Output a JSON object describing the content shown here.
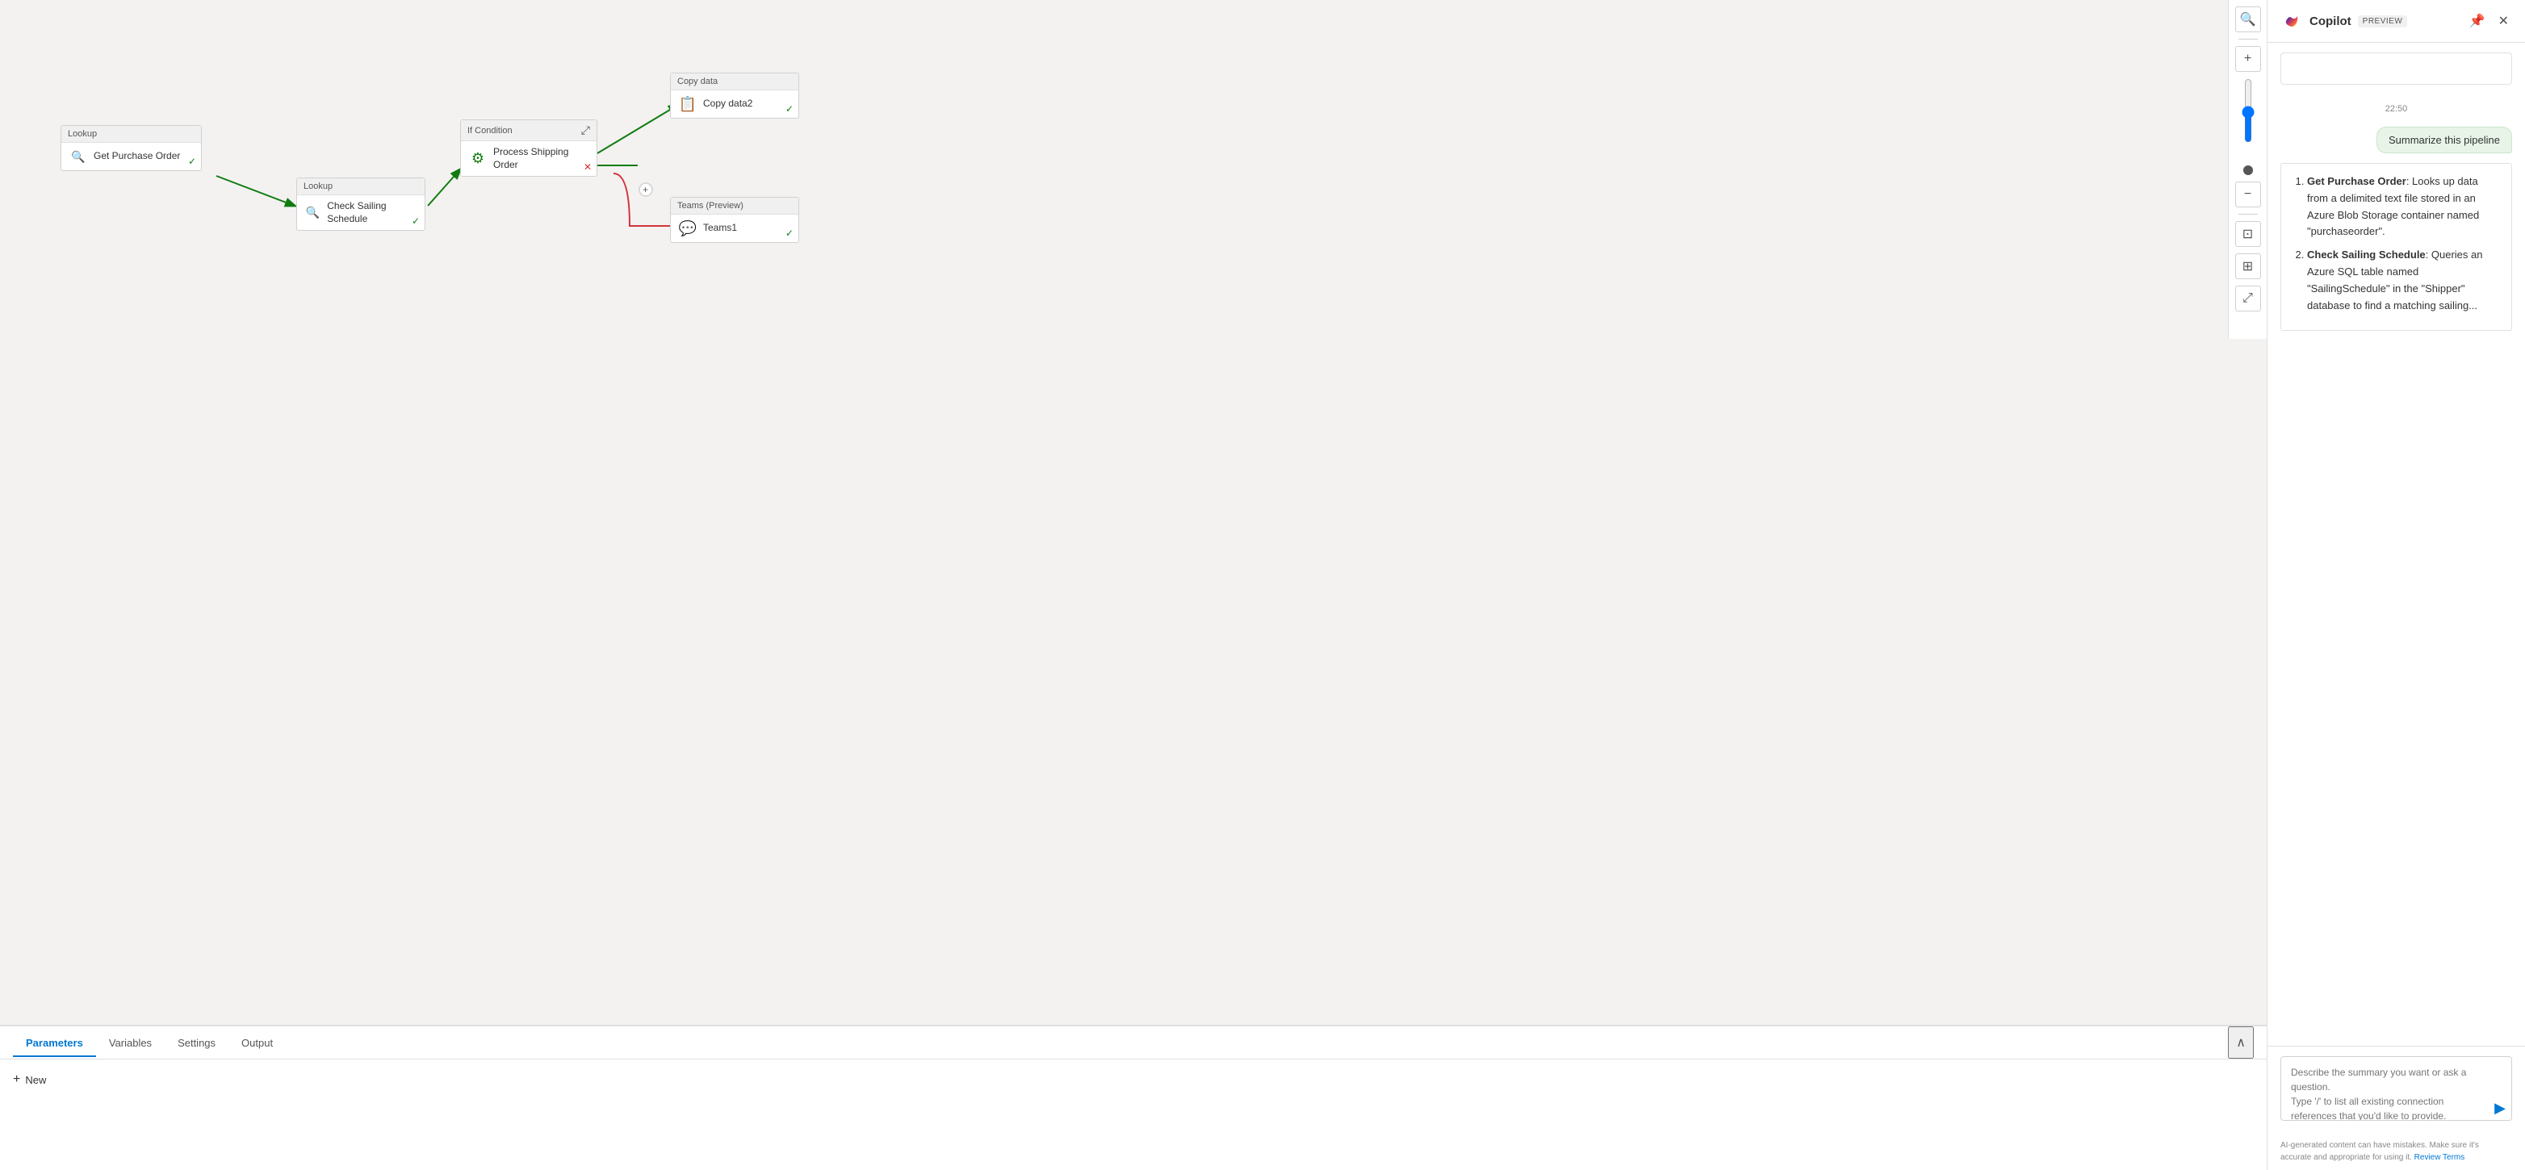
{
  "copilot": {
    "title": "Copilot",
    "preview_badge": "PREVIEW",
    "timestamp": "22:50",
    "user_message": "Summarize this pipeline",
    "bot_response": {
      "items": [
        {
          "name": "Get Purchase Order",
          "description": ": Looks up data from a delimited text file stored in an Azure Blob Storage container named \"purchaseorder\"."
        },
        {
          "name": "Check Sailing Schedule",
          "description": ": Queries an Azure SQL table named \"SailingSchedule\" in the \"Shipper\" database to find a matching sailing..."
        }
      ]
    },
    "input_placeholder": "Describe the summary you want or ask a question.\nType '/' to list all existing connection references that you'd like to provide.",
    "footer_text": "AI-generated content can have mistakes. Make sure it's accurate and appropriate for using it. ",
    "review_terms": "Review Terms"
  },
  "nodes": {
    "lookup1": {
      "header": "Lookup",
      "label": "Get Purchase Order"
    },
    "lookup2": {
      "header": "Lookup",
      "label": "Check Sailing Schedule"
    },
    "ifcondition": {
      "header": "If Condition",
      "label": ""
    },
    "process_shipping": {
      "header": "",
      "label": "Process Shipping Order"
    },
    "copy_data": {
      "header": "Copy data",
      "label": "Copy data2"
    },
    "teams": {
      "header": "Teams (Preview)",
      "label": "Teams1"
    }
  },
  "bottom_panel": {
    "tabs": [
      {
        "label": "Parameters",
        "active": true
      },
      {
        "label": "Variables",
        "active": false
      },
      {
        "label": "Settings",
        "active": false
      },
      {
        "label": "Output",
        "active": false
      }
    ],
    "add_new_label": "New"
  },
  "toolbar": {
    "search_icon": "🔍",
    "zoom_in": "+",
    "zoom_out": "−",
    "fit_icon": "⊡",
    "grid_icon": "⊞",
    "expand_icon": "⤢"
  }
}
